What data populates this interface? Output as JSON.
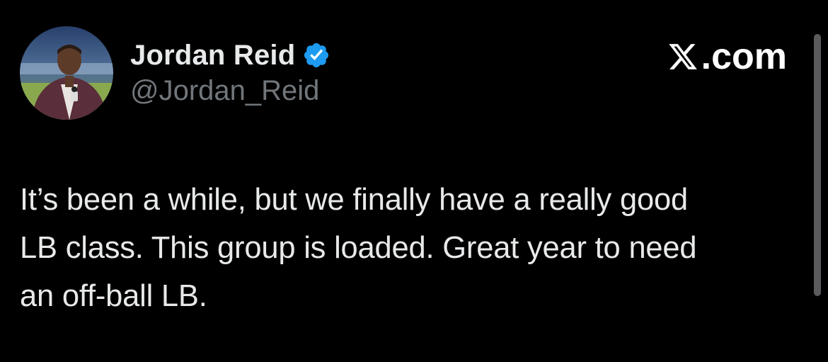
{
  "author": {
    "display_name": "Jordan Reid",
    "handle": "@Jordan_Reid",
    "verified": true,
    "avatar_icon": "avatar-photo"
  },
  "brand": {
    "label": ".com",
    "icon": "x-logo-icon"
  },
  "tweet": {
    "text": "It’s been a while, but we finally have a really good\nLB class. This group is loaded. Great year to need\nan off-ball LB."
  },
  "colors": {
    "background": "#000000",
    "primary_text": "#e7e9ea",
    "secondary_text": "#71767b",
    "verified_blue": "#1d9bf0"
  }
}
